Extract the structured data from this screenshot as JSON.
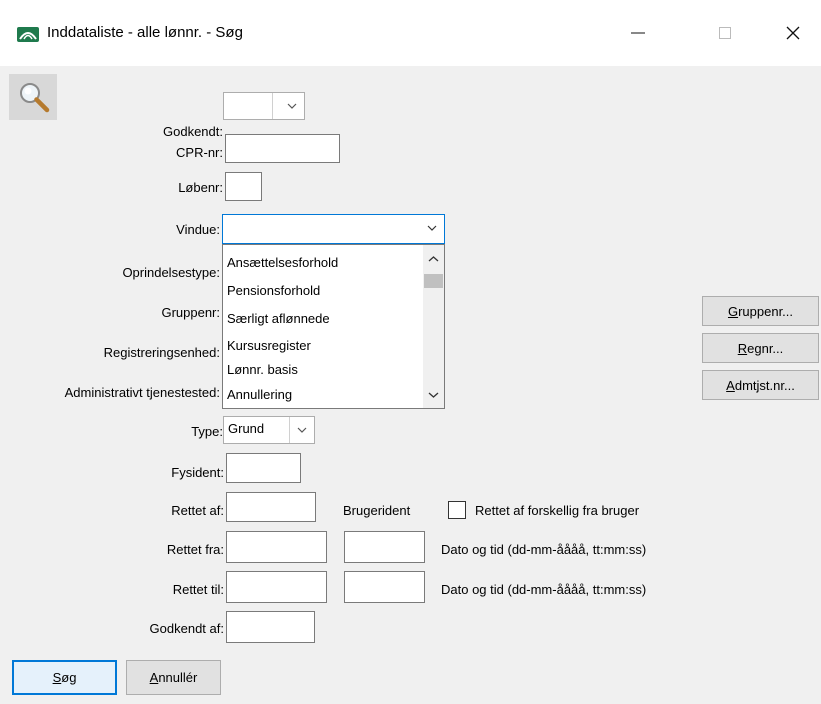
{
  "window": {
    "title": "Inddataliste - alle lønnr. - Søg",
    "icon": "app-logo-icon",
    "controls": {
      "minimize": "minimize-icon",
      "maximize": "maximize-icon",
      "close": "close-icon"
    }
  },
  "toolbar": {
    "search_icon": "magnifier-icon"
  },
  "form": {
    "godkendt": {
      "label": "Godkendt:",
      "value": ""
    },
    "cpr": {
      "label": "CPR-nr:",
      "value": ""
    },
    "loebenr": {
      "label": "Løbenr:",
      "value": ""
    },
    "vindue": {
      "label": "Vindue:",
      "value": "",
      "options": [
        "Ansættelsesforhold",
        "Pensionsforhold",
        "Særligt aflønnede",
        "Kursusregister",
        "Lønnr. basis",
        "Annullering"
      ]
    },
    "oprindelsestype": {
      "label": "Oprindelsestype:"
    },
    "gruppenr": {
      "label": "Gruppenr:"
    },
    "registreringsenhed": {
      "label": "Registreringsenhed:"
    },
    "admin_tjenestested": {
      "label": "Administrativt tjenestested:"
    },
    "type": {
      "label": "Type:",
      "value": "Grund"
    },
    "fysident": {
      "label": "Fysident:",
      "value": ""
    },
    "rettet_af": {
      "label": "Rettet af:",
      "value": ""
    },
    "brugerident": {
      "label": "Brugerident"
    },
    "rettet_af_forskellig": {
      "label": "Rettet af forskellig fra bruger",
      "checked": false
    },
    "rettet_fra": {
      "label": "Rettet fra:",
      "hint": "Dato og tid (dd-mm-åååå, tt:mm:ss)"
    },
    "rettet_til": {
      "label": "Rettet til:",
      "hint": "Dato og tid (dd-mm-åååå, tt:mm:ss)"
    },
    "godkendt_af": {
      "label": "Godkendt af:",
      "value": ""
    }
  },
  "side_buttons": {
    "gruppenr": {
      "mnemonic": "G",
      "rest": "ruppenr..."
    },
    "regnr": {
      "mnemonic": "R",
      "rest": "egnr..."
    },
    "admtjst": {
      "mnemonic": "A",
      "rest": "dmtjst.nr..."
    }
  },
  "footer": {
    "search": {
      "mnemonic": "S",
      "rest": "øg"
    },
    "cancel": {
      "mnemonic": "A",
      "rest": "nnullér"
    }
  },
  "colors": {
    "focus": "#0078d7",
    "window_bg": "#f0f0f0"
  }
}
